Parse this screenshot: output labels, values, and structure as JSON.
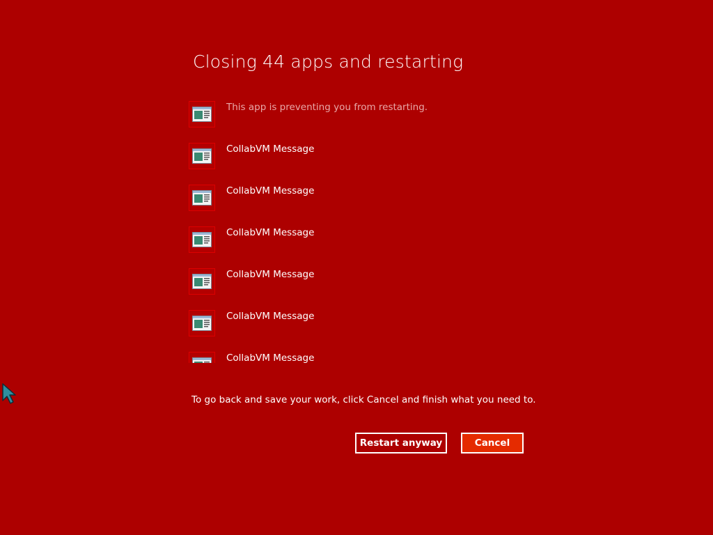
{
  "dialog": {
    "title": "Closing 44 apps and restarting",
    "hint": "To go back and save your work, click Cancel and finish what you need to."
  },
  "apps": [
    {
      "label": "This app is preventing you from restarting.",
      "icon": "app-window-icon"
    },
    {
      "label": "CollabVM Message",
      "icon": "app-window-icon"
    },
    {
      "label": "CollabVM Message",
      "icon": "app-window-icon"
    },
    {
      "label": "CollabVM Message",
      "icon": "app-window-icon"
    },
    {
      "label": "CollabVM Message",
      "icon": "app-window-icon"
    },
    {
      "label": "CollabVM Message",
      "icon": "app-window-icon"
    },
    {
      "label": "CollabVM Message",
      "icon": "app-window-icon"
    }
  ],
  "buttons": {
    "restart_label": "Restart anyway",
    "cancel_label": "Cancel"
  },
  "colors": {
    "background": "#ad0000",
    "cancel_accent": "#e52b00",
    "text": "#ffffff"
  }
}
